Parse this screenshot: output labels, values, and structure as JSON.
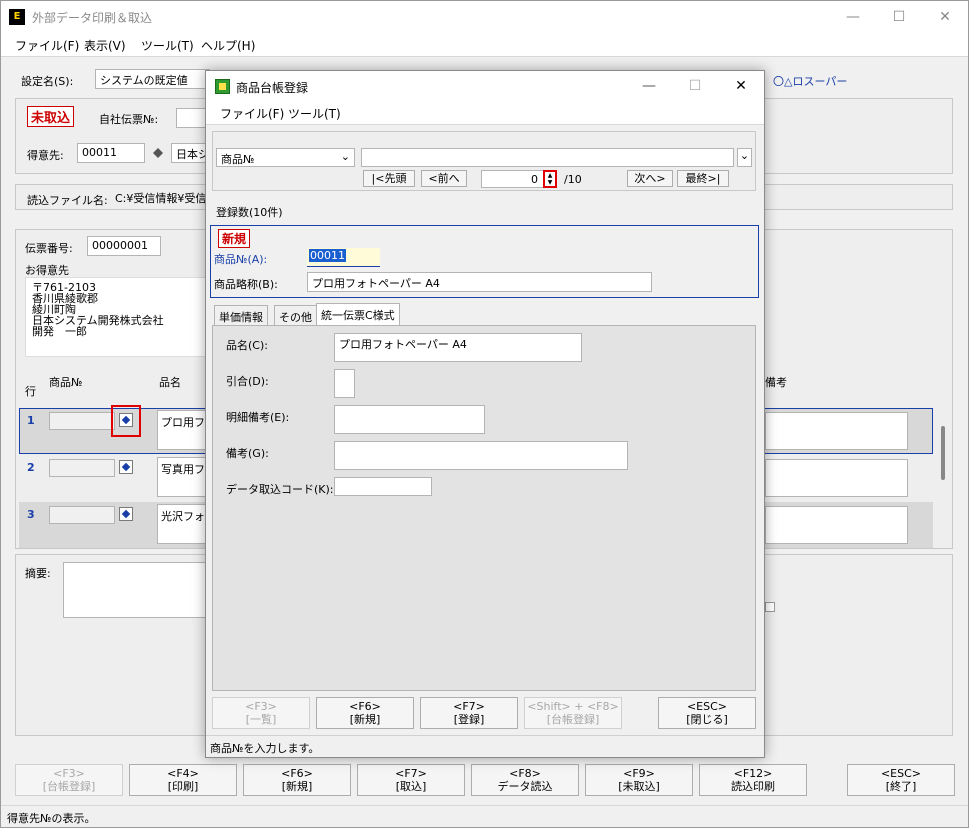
{
  "main": {
    "title": "外部データ印刷＆取込",
    "app_icon_text": "E",
    "menu": [
      "ファイル(F)",
      "表示(V)",
      "ツール(T)",
      "ヘルプ(H)"
    ],
    "setting_label": "設定名(S):",
    "setting_value": "システムの既定値",
    "company_link": "〇△ロスーパー",
    "status_tag": "未取込",
    "slip_company_label": "自社伝票№:",
    "customer_label": "得意先:",
    "customer_code": "00011",
    "customer_name": "日本シ",
    "read_file_label": "読込ファイル名:",
    "read_file_value": "C:¥受信情報¥受信",
    "slip_no_label": "伝票番号:",
    "slip_no_value": "00000001",
    "customer_block_label": "お得意先",
    "address_lines": [
      "〒761-2103",
      "香川県綾歌郡",
      "綾川町陶",
      "日本システム開発株式会社",
      "開発　一郎"
    ],
    "col_row": "行",
    "col_product_no": "商品№",
    "col_product_name": "品名",
    "col_note": "備考",
    "rows": [
      {
        "no": "1",
        "name": "プロ用フォ"
      },
      {
        "no": "2",
        "name": "写真用フ"
      },
      {
        "no": "3",
        "name": "光沢フォ"
      }
    ],
    "summary_label": "摘要:",
    "buttons": [
      {
        "key": "<F3>",
        "label": "[台帳登録]",
        "disabled": true
      },
      {
        "key": "<F4>",
        "label": "[印刷]"
      },
      {
        "key": "<F6>",
        "label": "[新規]"
      },
      {
        "key": "<F7>",
        "label": "[取込]"
      },
      {
        "key": "<F8>",
        "label": "データ読込"
      },
      {
        "key": "<F9>",
        "label": "[未取込]"
      },
      {
        "key": "<F12>",
        "label": "読込印刷"
      },
      {
        "key": "<ESC>",
        "label": "[終了]"
      }
    ],
    "status_text": "得意先№の表示。"
  },
  "dialog": {
    "title": "商品台帳登録",
    "menu": [
      "ファイル(F)",
      "ツール(T)"
    ],
    "search_type": "商品№",
    "nav": {
      "first": "|<先頭",
      "prev": "<前へ",
      "page_value": "0",
      "page_total": "/10",
      "next": "次へ>",
      "last": "最終>|"
    },
    "count_label": "登録数(10件)",
    "status_tag": "新規",
    "product_no_label": "商品№(A):",
    "product_no_value": "00011",
    "short_name_label": "商品略称(B):",
    "short_name_value": "プロ用フォトペーパー A4",
    "tabs": [
      "単価情報",
      "その他",
      "統一伝票C様式"
    ],
    "product_name_label": "品名(C):",
    "product_name_value": "プロ用フォトペーパー A4",
    "discount_label": "引合(D):",
    "detail_note_label": "明細備考(E):",
    "note_label": "備考(G):",
    "data_code_label": "データ取込コード(K):",
    "buttons": [
      {
        "key": "<F3>",
        "label": "[一覧]",
        "disabled": true
      },
      {
        "key": "<F6>",
        "label": "[新規]"
      },
      {
        "key": "<F7>",
        "label": "[登録]"
      },
      {
        "key": "<Shift> + <F8>",
        "label": "[台帳登録]",
        "disabled": true
      },
      {
        "key": "<ESC>",
        "label": "[閉じる]"
      }
    ],
    "status_text": "商品№を入力します。"
  },
  "colors": {
    "accent_blue": "#1a3fa8",
    "tag_red": "#cc0000",
    "highlight_red": "#e00000"
  },
  "icons": [
    "app-icon",
    "minimize-icon",
    "maximize-icon",
    "close-icon",
    "chevron-down-icon",
    "diamond-icon"
  ]
}
